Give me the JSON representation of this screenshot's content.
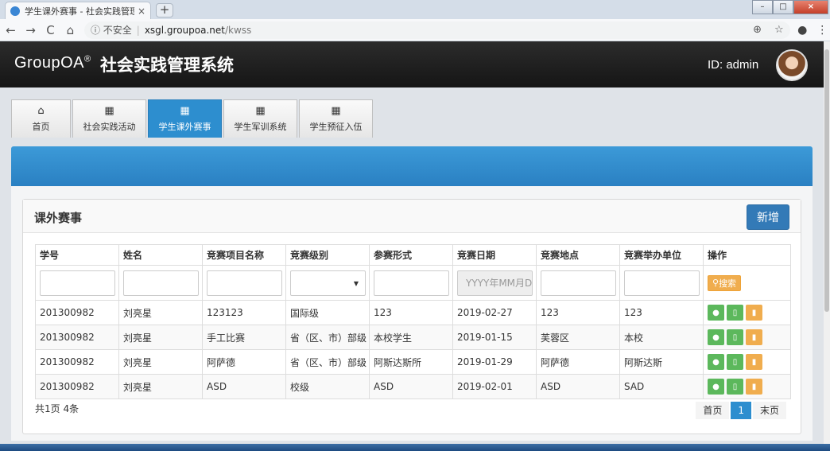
{
  "browser": {
    "tab_title": "学生课外赛事 - 社会实践管理系统",
    "tab_close": "×",
    "new_tab": "+",
    "back": "←",
    "forward": "→",
    "reload": "C",
    "home": "⌂",
    "secure_label": "ⓘ 不安全",
    "url_host": "xsgl.groupoa.net",
    "url_path": "/kwss",
    "zoom_icon": "⊕",
    "star_icon": "☆",
    "account_icon": "●",
    "menu_icon": "⋮",
    "win_min": "–",
    "win_max": "□",
    "win_close": "×"
  },
  "header": {
    "logo": "GroupOA",
    "logo_mark": "®",
    "system_title": "社会实践管理系统",
    "user_id": "ID: admin"
  },
  "nav": {
    "tabs": [
      {
        "icon": "⌂",
        "label": "首页"
      },
      {
        "icon": "▦",
        "label": "社会实践活动"
      },
      {
        "icon": "▦",
        "label": "学生课外赛事"
      },
      {
        "icon": "▦",
        "label": "学生军训系统"
      },
      {
        "icon": "▦",
        "label": "学生预征入伍"
      }
    ],
    "active_index": 2
  },
  "panel": {
    "title": "课外赛事",
    "add_label": "新增"
  },
  "table": {
    "headers": [
      "学号",
      "姓名",
      "竞赛项目名称",
      "竞赛级别",
      "参赛形式",
      "竞赛日期",
      "竞赛地点",
      "竞赛举办单位",
      "操作"
    ],
    "date_placeholder": "YYYY年MM月DD日",
    "search_label": "搜索",
    "select_caret": "▼",
    "rows": [
      [
        "201300982",
        "刘亮星",
        "123123",
        "国际级",
        "123",
        "2019-02-27",
        "123",
        "123"
      ],
      [
        "201300982",
        "刘亮星",
        "手工比赛",
        "省（区、市）部级",
        "本校学生",
        "2019-01-15",
        "芙蓉区",
        "本校"
      ],
      [
        "201300982",
        "刘亮星",
        "阿萨德",
        "省（区、市）部级",
        "阿斯达斯所",
        "2019-01-29",
        "阿萨德",
        "阿斯达斯"
      ],
      [
        "201300982",
        "刘亮星",
        "ASD",
        "校级",
        "ASD",
        "2019-02-01",
        "ASD",
        "SAD"
      ]
    ]
  },
  "footer": {
    "summary": "共1页 4条",
    "first": "首页",
    "current": "1",
    "last": "末页"
  }
}
